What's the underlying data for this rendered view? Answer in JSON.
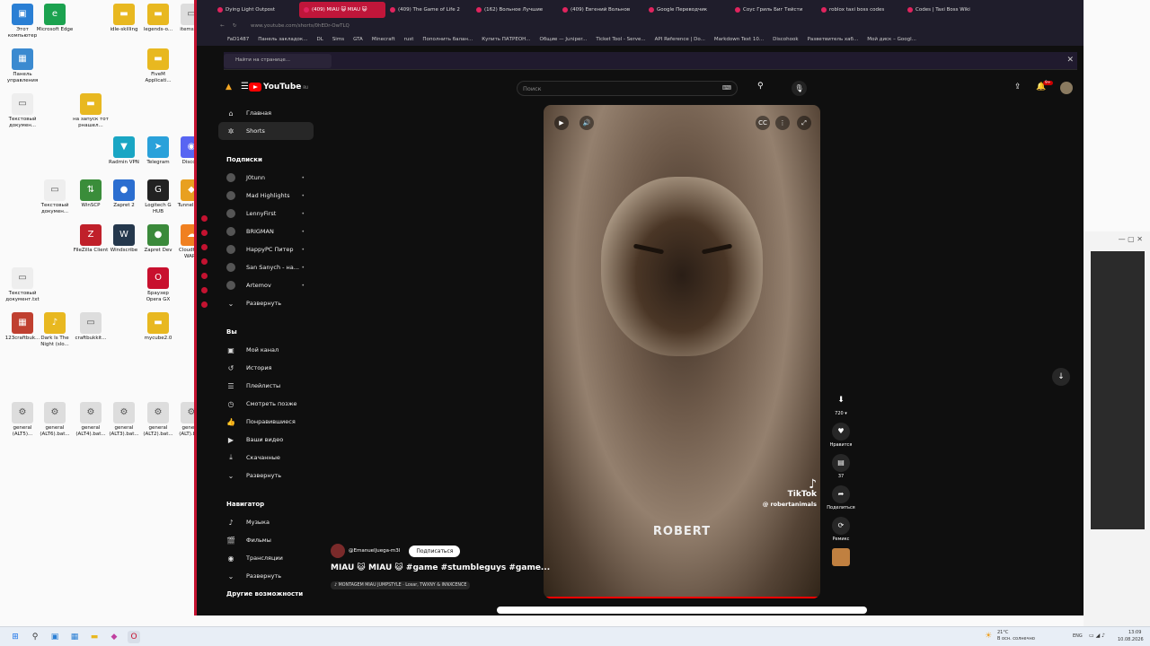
{
  "desktop_icons": [
    {
      "label": "Этот компьютер",
      "color": "#2a7fd4",
      "glyph": "▣"
    },
    {
      "label": "Microsoft Edge",
      "color": "#1ba24f",
      "glyph": "e"
    },
    {
      "label": "idle-skilling",
      "color": "#e8b820",
      "glyph": "▬"
    },
    {
      "label": "legends-o...",
      "color": "#e8b820",
      "glyph": "▬"
    },
    {
      "label": "items.lua",
      "color": "#ddd",
      "glyph": "▭"
    },
    {
      "label": "Панель управления",
      "color": "#3b8ad0",
      "glyph": "▦"
    },
    {
      "label": "FiveM Applicati...",
      "color": "#e8b820",
      "glyph": "▬"
    },
    {
      "label": "Текстовый докумен...",
      "color": "#eee",
      "glyph": "▭"
    },
    {
      "label": "на запуск тот рнашел...",
      "color": "#e8b820",
      "glyph": "▬"
    },
    {
      "label": "Radmin VPN",
      "color": "#1aa6c4",
      "glyph": "▼"
    },
    {
      "label": "Telegram",
      "color": "#2aa1da",
      "glyph": "➤"
    },
    {
      "label": "Discord",
      "color": "#5865f2",
      "glyph": "◉"
    },
    {
      "label": "Текстовый докумен...",
      "color": "#eee",
      "glyph": "▭"
    },
    {
      "label": "WinSCP",
      "color": "#3a8d3a",
      "glyph": "⇅"
    },
    {
      "label": "Zapret 2",
      "color": "#2b6ed0",
      "glyph": "●"
    },
    {
      "label": "Logitech G HUB",
      "color": "#222",
      "glyph": "G"
    },
    {
      "label": "TunnelBear",
      "color": "#e8a020",
      "glyph": "◆"
    },
    {
      "label": "FileZilla Client",
      "color": "#c0202a",
      "glyph": "Z"
    },
    {
      "label": "Windscribe",
      "color": "#25384d",
      "glyph": "W"
    },
    {
      "label": "Zapret Dev",
      "color": "#3b8a3b",
      "glyph": "●"
    },
    {
      "label": "Cloudflare WARP",
      "color": "#f08020",
      "glyph": "☁"
    },
    {
      "label": "Текстовый документ.txt",
      "color": "#eee",
      "glyph": "▭"
    },
    {
      "label": "Браузер Opera GX",
      "color": "#c8102e",
      "glyph": "O"
    },
    {
      "label": "123craftbuk...",
      "color": "#c04030",
      "glyph": "▦"
    },
    {
      "label": "Dark Is The Night (slo...",
      "color": "#e8b820",
      "glyph": "♪"
    },
    {
      "label": "craftbukkit...",
      "color": "#ddd",
      "glyph": "▭"
    },
    {
      "label": "mycube2.0",
      "color": "#e8b820",
      "glyph": "▬"
    },
    {
      "label": "general (ALT5)...",
      "color": "#ddd",
      "glyph": "⚙"
    },
    {
      "label": "general (ALT6).bat...",
      "color": "#ddd",
      "glyph": "⚙"
    },
    {
      "label": "general (ALT4).bat...",
      "color": "#ddd",
      "glyph": "⚙"
    },
    {
      "label": "general (ALT3).bat...",
      "color": "#ddd",
      "glyph": "⚙"
    },
    {
      "label": "general (ALT2).bat...",
      "color": "#ddd",
      "glyph": "⚙"
    },
    {
      "label": "general (ALT).ba...",
      "color": "#ddd",
      "glyph": "⚙"
    }
  ],
  "tabs": [
    {
      "label": "Dying Light Outpost",
      "active": false
    },
    {
      "label": "(409) MIAU 😺 MIAU 😺",
      "active": true
    },
    {
      "label": "(409) The Game of Life 2",
      "active": false
    },
    {
      "label": "(162) Вольное Лучшие",
      "active": false
    },
    {
      "label": "(409) Евгений Вольнов",
      "active": false
    },
    {
      "label": "Google Переводчик",
      "active": false
    },
    {
      "label": "Соус Гриль Биг Тейсти",
      "active": false
    },
    {
      "label": "roblox taxi boss codes",
      "active": false
    },
    {
      "label": "Codes | Taxi Boss Wiki",
      "active": false
    }
  ],
  "address_url": "www.youtube.com/shorts/0hEDr-OwTLQ",
  "bookmarks": [
    "FaD1487",
    "Панель закладок...",
    "DL",
    "Sims",
    "GTA",
    "Minecraft",
    "rust",
    "Пополнить балан...",
    "Купить ПАТРЕОН...",
    "Общие — Juniper...",
    "Ticket Tool - Serve...",
    "API Reference | Do...",
    "Markdown Text 10...",
    "Discohook",
    "Разветвитель хаб...",
    "Мой диск – Googl..."
  ],
  "findbar_placeholder": "Найти на странице...",
  "yt": {
    "logo_text": "YouTube",
    "logo_region": "RU",
    "search_placeholder": "Поиск",
    "notif_count": "9+",
    "nav_main": [
      {
        "icon": "⌂",
        "label": "Главная",
        "name": "home-icon"
      },
      {
        "icon": "✲",
        "label": "Shorts",
        "name": "shorts-icon",
        "active": true
      }
    ],
    "subs_header": "Подписки",
    "subscriptions": [
      "J0tunn",
      "Mad Highlights",
      "LennyFirst",
      "BRIGMAN",
      "HappyPC Питер",
      "San Sanych - на...",
      "Artemov"
    ],
    "subs_expand": "Развернуть",
    "you_header": "Вы",
    "you_items": [
      {
        "icon": "▣",
        "label": "Мой канал",
        "name": "my-channel-icon"
      },
      {
        "icon": "↺",
        "label": "История",
        "name": "history-icon"
      },
      {
        "icon": "☰",
        "label": "Плейлисты",
        "name": "playlists-icon"
      },
      {
        "icon": "◷",
        "label": "Смотреть позже",
        "name": "watch-later-icon"
      },
      {
        "icon": "👍",
        "label": "Понравившиеся",
        "name": "liked-icon"
      },
      {
        "icon": "▶",
        "label": "Ваши видео",
        "name": "your-videos-icon"
      },
      {
        "icon": "⤓",
        "label": "Скачанные",
        "name": "downloads-icon"
      }
    ],
    "you_expand": "Развернуть",
    "nav_header": "Навигатор",
    "navigator": [
      {
        "icon": "♪",
        "label": "Музыка",
        "name": "music-icon"
      },
      {
        "icon": "🎬",
        "label": "Фильмы",
        "name": "movies-icon"
      },
      {
        "icon": "◉",
        "label": "Трансляции",
        "name": "live-icon"
      }
    ],
    "nav_expand": "Развернуть",
    "more_header": "Другие возможности",
    "video_overlay": "ROBERT",
    "tiktok_brand": "TikTok",
    "tiktok_handle": "@ robertanimals",
    "quality": "720",
    "like_label": "Нравится",
    "comments_count": "37",
    "share_label": "Поделиться",
    "remix_label": "Ремикс",
    "channel": "@EmanuelJuega-m3l",
    "subscribe_label": "Подписаться",
    "title": "MIAU 😺 MIAU 😺 #game #stumbleguys #game...",
    "music": "♪ MONTAGEM MIAU JUMPSTYLE · Losar, TWXNY & INNXCENCE"
  },
  "taskbar": {
    "weather": "21°C",
    "weather_sub": "В осн. солнечно",
    "lang": "ENG",
    "time": "13:09",
    "date": "10.08.2026"
  }
}
